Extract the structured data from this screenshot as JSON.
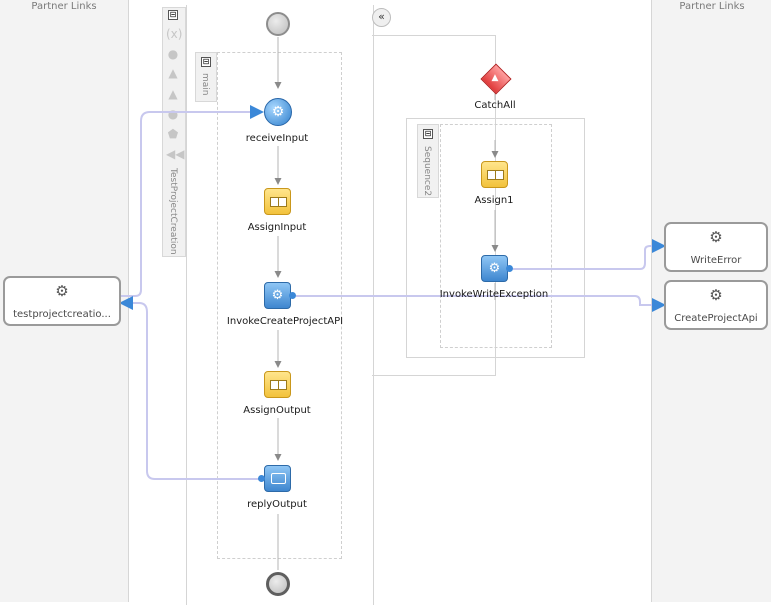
{
  "partner_links": {
    "left_title": "Partner Links",
    "right_title": "Partner Links",
    "left": [
      {
        "label": "testprojectcreatio..."
      }
    ],
    "right": [
      {
        "label": "WriteError"
      },
      {
        "label": "CreateProjectApi"
      }
    ]
  },
  "scopes": {
    "process": {
      "label": "TestProjectCreation"
    },
    "main": {
      "label": "main"
    },
    "sequence2": {
      "label": "Sequence2"
    }
  },
  "activities": {
    "receive_input": {
      "label": "receiveInput"
    },
    "assign_input": {
      "label": "AssignInput"
    },
    "invoke_create": {
      "label": "InvokeCreateProjectAPI"
    },
    "assign_output": {
      "label": "AssignOutput"
    },
    "reply_output": {
      "label": "replyOutput"
    },
    "catch_all": {
      "label": "CatchAll"
    },
    "assign1": {
      "label": "Assign1"
    },
    "invoke_write_exception": {
      "label": "InvokeWriteException"
    }
  },
  "icons": {
    "collapse": "⊟",
    "expand": "«",
    "gear": "⚙"
  },
  "colors": {
    "link_line": "#c8c8ee",
    "assign_fill": "#f7d460",
    "invoke_fill": "#4a90d9",
    "catch_fill": "#e85050"
  }
}
